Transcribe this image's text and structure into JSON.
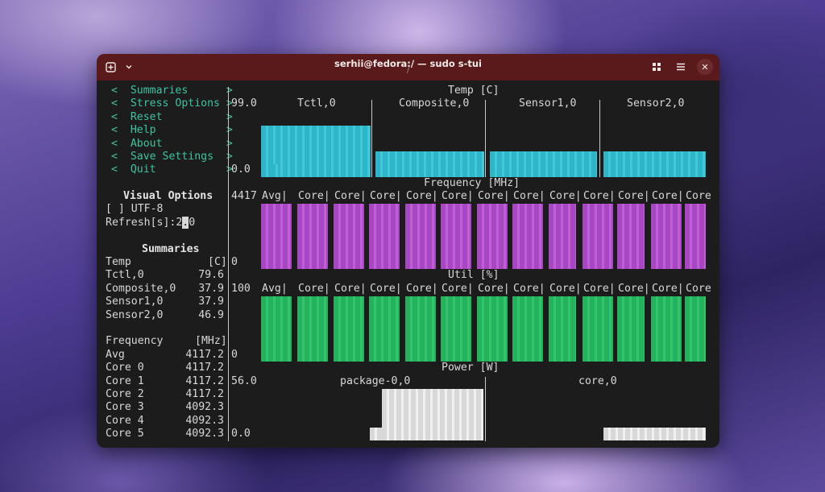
{
  "window": {
    "title": "serhii@fedora:/ — sudo s-tui",
    "subtitle": "/"
  },
  "menu": [
    {
      "label": "<  Summaries      >"
    },
    {
      "label": "<  Stress Options >"
    },
    {
      "label": "<  Reset          >"
    },
    {
      "label": "<  Help           >"
    },
    {
      "label": "<  About          >"
    },
    {
      "label": "<  Save Settings  >"
    },
    {
      "label": "<  Quit           >"
    }
  ],
  "visual_options": {
    "title": "Visual Options",
    "utf8": "[ ] UTF-8",
    "refresh_label": "Refresh[s]:",
    "refresh_a": "2",
    "refresh_cursor": ".",
    "refresh_b": "0"
  },
  "summaries": {
    "title": "Summaries",
    "temp": {
      "label": "Temp",
      "unit": "[C]",
      "rows": [
        {
          "name": "Tctl,0",
          "value": "79.6"
        },
        {
          "name": "Composite,0",
          "value": "37.9"
        },
        {
          "name": "Sensor1,0",
          "value": "37.9"
        },
        {
          "name": "Sensor2,0",
          "value": "46.9"
        }
      ]
    },
    "freq": {
      "label": "Frequency",
      "unit": "[MHz]",
      "rows": [
        {
          "name": "Avg",
          "value": "4117.2"
        },
        {
          "name": "Core 0",
          "value": "4117.2"
        },
        {
          "name": "Core 1",
          "value": "4117.2"
        },
        {
          "name": "Core 2",
          "value": "4117.2"
        },
        {
          "name": "Core 3",
          "value": "4092.3"
        },
        {
          "name": "Core 4",
          "value": "4092.3"
        },
        {
          "name": "Core 5",
          "value": "4092.3"
        }
      ]
    }
  },
  "graphs": {
    "temp": {
      "title": "Temp [C]",
      "max": "99.0",
      "min": "0.0",
      "series": [
        "Tctl,0",
        "Composite,0",
        "Sensor1,0",
        "Sensor2,0"
      ],
      "levels": [
        0.8,
        0.38,
        0.38,
        0.38
      ]
    },
    "freq": {
      "title": "Frequency [MHz]",
      "max": "4417",
      "min": "0",
      "headers": [
        "Avg",
        "Core",
        "Core",
        "Core",
        "Core",
        "Core",
        "Core",
        "Core",
        "Core",
        "Core",
        "Core",
        "Core",
        "Core"
      ]
    },
    "util": {
      "title": "Util [%]",
      "max": "100",
      "min": "0",
      "headers": [
        "Avg",
        "Core",
        "Core",
        "Core",
        "Core",
        "Core",
        "Core",
        "Core",
        "Core",
        "Core",
        "Core",
        "Core",
        "Core"
      ]
    },
    "power": {
      "title": "Power [W]",
      "max": "56.0",
      "min": "0.0",
      "series": [
        "package-0,0",
        "core,0"
      ]
    }
  }
}
